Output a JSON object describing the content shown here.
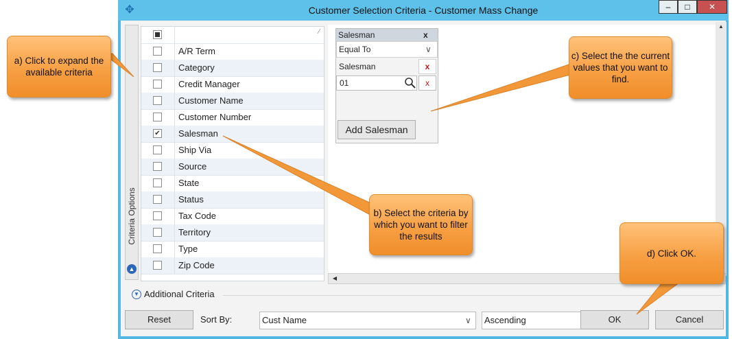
{
  "window": {
    "title": "Customer Selection Criteria - Customer Mass Change",
    "app_icon": "app-logo-icon",
    "controls": [
      "minimize-icon",
      "maximize-icon",
      "close-icon"
    ]
  },
  "criteria_options": {
    "label": "Criteria Options",
    "items": [
      {
        "label": "A/R Term",
        "checked": false
      },
      {
        "label": "Category",
        "checked": false
      },
      {
        "label": "Credit Manager",
        "checked": false
      },
      {
        "label": "Customer Name",
        "checked": false
      },
      {
        "label": "Customer Number",
        "checked": false
      },
      {
        "label": "Salesman",
        "checked": true
      },
      {
        "label": "Ship Via",
        "checked": false
      },
      {
        "label": "Source",
        "checked": false
      },
      {
        "label": "State",
        "checked": false
      },
      {
        "label": "Status",
        "checked": false
      },
      {
        "label": "Tax Code",
        "checked": false
      },
      {
        "label": "Territory",
        "checked": false
      },
      {
        "label": "Type",
        "checked": false
      },
      {
        "label": "Zip Code",
        "checked": false
      }
    ]
  },
  "salesman_panel": {
    "title": "Salesman",
    "close": "x",
    "operator": "Equal To",
    "field_label": "Salesman",
    "remove": "x",
    "value": "01",
    "add_button": "Add Salesman"
  },
  "additional_criteria": {
    "label": "Additional Criteria"
  },
  "footer": {
    "reset": "Reset",
    "sort_by_label": "Sort By:",
    "sort_field": "Cust Name",
    "sort_order": "Ascending",
    "ok": "OK",
    "cancel": "Cancel"
  },
  "callouts": {
    "a": "a) Click to expand the available criteria",
    "b": "b) Select the criteria by which you want to filter the results",
    "c": "c) Select the the current values that you want to find.",
    "d": "d) Click OK."
  },
  "colors": {
    "title_bar": "#5ec1ea",
    "callout": "#f7a044",
    "remove_x": "#c0141a"
  }
}
